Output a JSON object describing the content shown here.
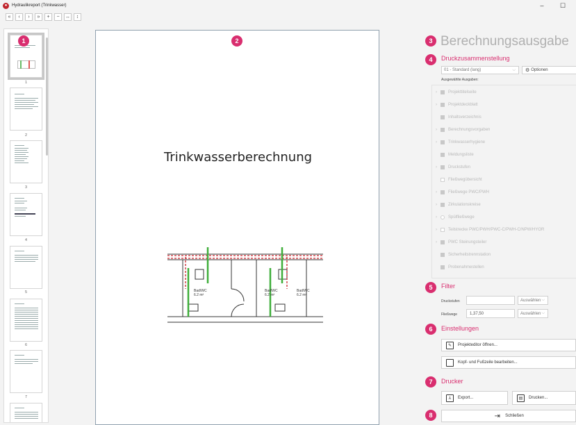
{
  "window": {
    "title": "Hydraulikreport (Trinkwasser)",
    "minimize": "–",
    "maximize": "☐"
  },
  "toolbar": {
    "first": "«",
    "prev": "‹",
    "next": "›",
    "last": "»",
    "zoom_in": "+",
    "zoom_out": "−",
    "fit_width": "↔",
    "fit_height": "↕"
  },
  "thumbnails": {
    "pages": [
      "1",
      "2",
      "3",
      "4",
      "5",
      "6",
      "7"
    ]
  },
  "preview": {
    "page_title": "Trinkwasserberechnung",
    "plan_labels": [
      "Bad/WC",
      "6.2 m²",
      "Bad/WC",
      "6.2 m²",
      "Bad/WC",
      "6.2 m²"
    ]
  },
  "badges": [
    "1",
    "2",
    "3",
    "4",
    "5",
    "6",
    "7",
    "8"
  ],
  "panel": {
    "title": "Berechnungsausgabe",
    "print_section": {
      "heading": "Druckzusammenstellung",
      "preset": "01 - Standard (lang)",
      "options_label": "Optionen",
      "selected_outputs_label": "Ausgewählte Ausgaben:",
      "tree": [
        {
          "label": "Projekttitelseite",
          "expandable": true,
          "check": "filled"
        },
        {
          "label": "Projektdeckblatt",
          "expandable": true,
          "check": "filled"
        },
        {
          "label": "Inhaltsverzeichnis",
          "expandable": false,
          "check": "filled"
        },
        {
          "label": "Berechnungsvorgaben",
          "expandable": true,
          "check": "filled"
        },
        {
          "label": "Trinkwasserhygiene",
          "expandable": true,
          "check": "filled"
        },
        {
          "label": "Meldungsliste",
          "expandable": false,
          "check": "filled"
        },
        {
          "label": "Druckstufen",
          "expandable": true,
          "check": "filled"
        },
        {
          "label": "Fließwegübersicht",
          "expandable": false,
          "check": "empty"
        },
        {
          "label": "Fließwege PWC/PWH",
          "expandable": true,
          "check": "filled"
        },
        {
          "label": "Zirkulationskreise",
          "expandable": true,
          "check": "filled"
        },
        {
          "label": "Spülfließwege",
          "expandable": true,
          "check": "circle"
        },
        {
          "label": "Teilstrecke PWC/PWH/PWC-C/PWH-C/NPW/HYOR",
          "expandable": true,
          "check": "empty"
        },
        {
          "label": "PWC Steinungsteiler",
          "expandable": true,
          "check": "filled"
        },
        {
          "label": "Sicherheitstrennstation",
          "expandable": false,
          "check": "filled"
        },
        {
          "label": "Probenahmestellen",
          "expandable": false,
          "check": "filled"
        }
      ]
    },
    "filter_section": {
      "heading": "Filter",
      "druckstufen_label": "Druckstufen",
      "druckstufen_value": "",
      "druckstufen_select": "Auswählen",
      "fliesswege_label": "Fließwege",
      "fliesswege_value": "1,37,50",
      "fliesswege_select": "Auswählen"
    },
    "settings_section": {
      "heading": "Einstellungen",
      "project_editor_button": "Projekteditor öffnen...",
      "header_footer_button": "Kopf- und Fußzeile bearbeiten..."
    },
    "printer_section": {
      "heading": "Drucker",
      "export_button": "Export...",
      "print_button": "Drucken..."
    },
    "close_button": "Schließen"
  },
  "colors": {
    "accent": "#d92e6f",
    "muted_heading": "#b0b0b0",
    "app_icon": "#c0262d"
  }
}
